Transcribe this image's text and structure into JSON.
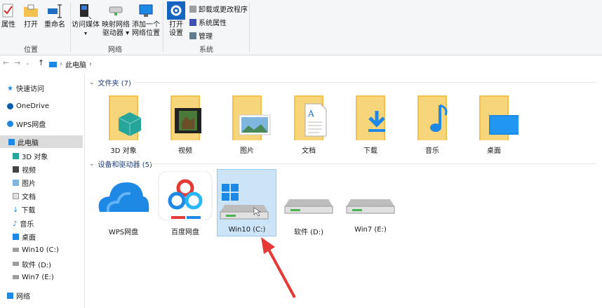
{
  "ribbon": {
    "location_group": {
      "label": "位置",
      "properties": "属性",
      "open": "打开",
      "rename": "重命名"
    },
    "network_group": {
      "label": "网络",
      "access_media": "访问媒体",
      "map_drive_line1": "映射网络",
      "map_drive_line2": "驱动器",
      "add_location_line1": "添加一个",
      "add_location_line2": "网络位置"
    },
    "system_group": {
      "label": "系统",
      "open_settings_line1": "打开",
      "open_settings_line2": "设置",
      "uninstall": "卸载或更改程序",
      "system_properties": "系统属性",
      "manage": "管理"
    }
  },
  "address": {
    "path": "此电脑"
  },
  "sidebar": {
    "items": [
      {
        "label": "快速访问"
      },
      {
        "label": "OneDrive"
      },
      {
        "label": "WPS网盘"
      },
      {
        "label": "此电脑"
      },
      {
        "label": "3D 对象"
      },
      {
        "label": "视频"
      },
      {
        "label": "图片"
      },
      {
        "label": "文档"
      },
      {
        "label": "下载"
      },
      {
        "label": "音乐"
      },
      {
        "label": "桌面"
      },
      {
        "label": "Win10 (C:)"
      },
      {
        "label": "软件 (D:)"
      },
      {
        "label": "Win7 (E:)"
      },
      {
        "label": "网络"
      }
    ]
  },
  "folders_section": {
    "title": "文件夹 (7)",
    "items": [
      {
        "label": "3D 对象"
      },
      {
        "label": "视频"
      },
      {
        "label": "图片"
      },
      {
        "label": "文档"
      },
      {
        "label": "下载"
      },
      {
        "label": "音乐"
      },
      {
        "label": "桌面"
      }
    ]
  },
  "devices_section": {
    "title": "设备和驱动器 (5)",
    "items": [
      {
        "label": "WPS网盘"
      },
      {
        "label": "百度网盘"
      },
      {
        "label": "Win10 (C:)"
      },
      {
        "label": "软件 (D:)"
      },
      {
        "label": "Win7 (E:)"
      }
    ]
  },
  "colors": {
    "accent": "#0078d4",
    "selection": "#cce4f7",
    "arrow": "#e53935",
    "folder": "#f2c14e"
  }
}
